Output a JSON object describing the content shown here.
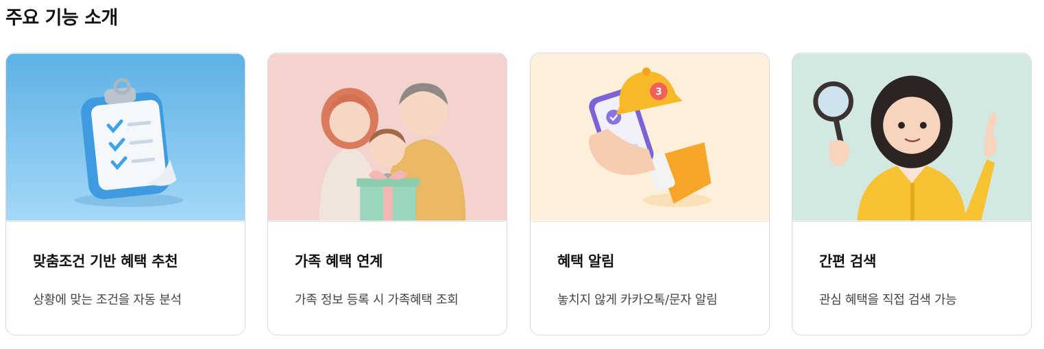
{
  "section": {
    "title": "주요 기능 소개"
  },
  "cards": [
    {
      "title": "맞춤조건 기반 혜택 추천",
      "description": "상황에 맞는 조건을 자동 분석",
      "image": "clipboard-checklist-illustration",
      "bg": "#7fc3ee"
    },
    {
      "title": "가족 혜택 연계",
      "description": "가족 정보 등록 시 가족혜택 조회",
      "image": "family-gift-illustration",
      "bg": "#f4d4cf"
    },
    {
      "title": "혜택 알림",
      "description": "놓치지 않게 카카오톡/문자 알림",
      "image": "phone-bell-notification-illustration",
      "bg": "#fdf0da",
      "badge": "3"
    },
    {
      "title": "간편 검색",
      "description": "관심 혜택을 직접 검색 가능",
      "image": "woman-magnifier-illustration",
      "bg": "#d3e8e0"
    }
  ]
}
